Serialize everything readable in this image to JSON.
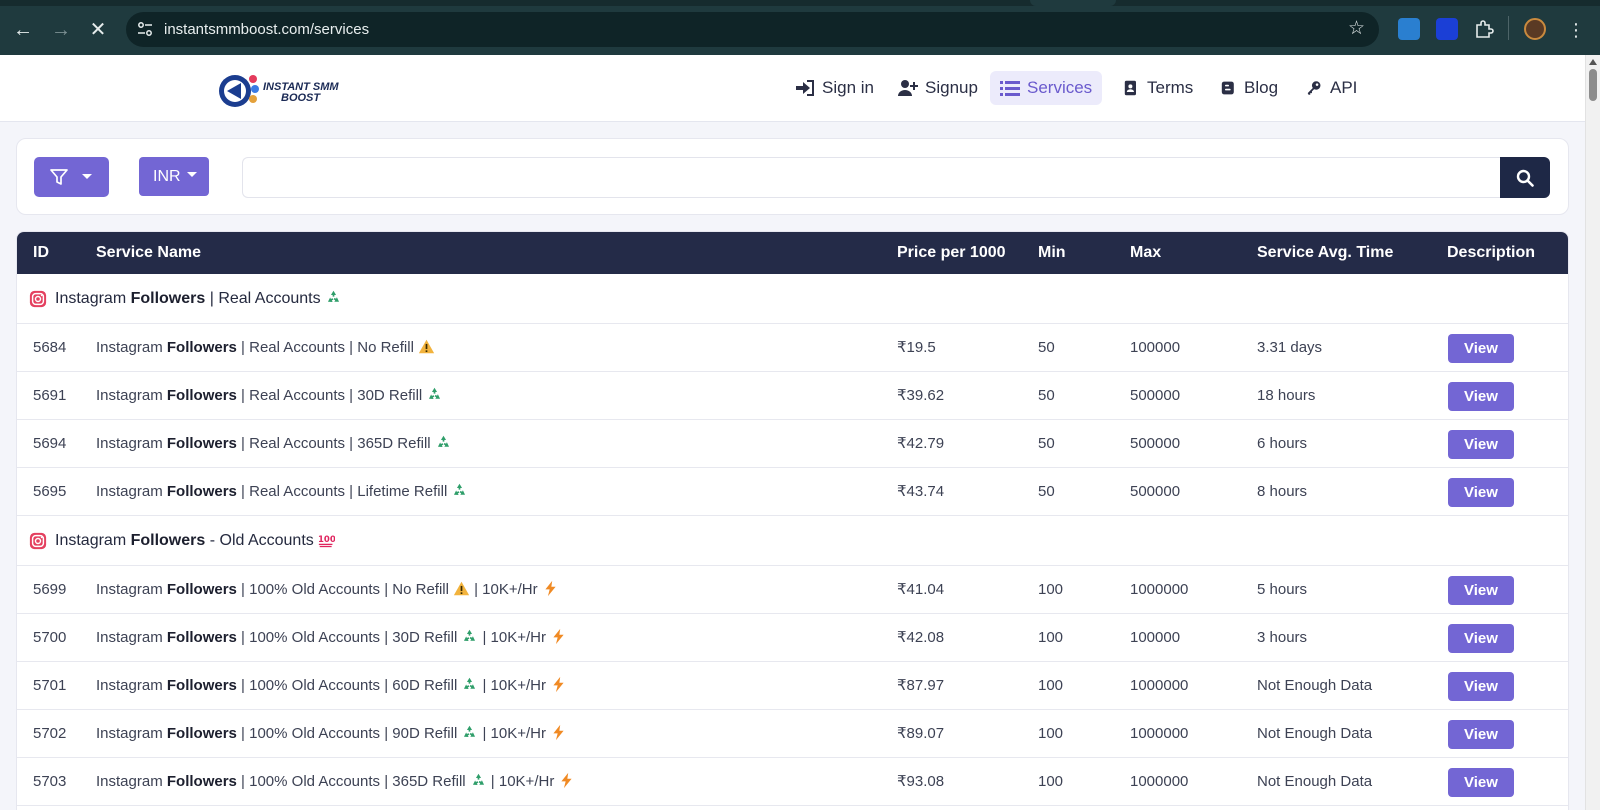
{
  "browser": {
    "url": "instantsmmboost.com/services"
  },
  "header": {
    "logo_text": "INSTANT SMM BOOST",
    "nav": [
      {
        "label": "Sign in",
        "icon": "sign-in-icon"
      },
      {
        "label": "Signup",
        "icon": "user-plus-icon"
      },
      {
        "label": "Services",
        "icon": "list-icon",
        "active": true
      },
      {
        "label": "Terms",
        "icon": "contact-card-icon"
      },
      {
        "label": "Blog",
        "icon": "blogger-icon"
      },
      {
        "label": "API",
        "icon": "key-icon"
      }
    ]
  },
  "filters": {
    "currency": "INR",
    "search_placeholder": ""
  },
  "table": {
    "headers": {
      "id": "ID",
      "name": "Service Name",
      "price": "Price per 1000",
      "min": "Min",
      "max": "Max",
      "avg": "Service Avg. Time",
      "desc": "Description"
    },
    "view_label": "View",
    "groups": [
      {
        "prefix": "Instagram ",
        "bold": "Followers",
        "suffix": " | Real Accounts",
        "emoji": "recycle-icon",
        "rows": [
          {
            "id": "5684",
            "prefix": "Instagram ",
            "bold": "Followers",
            "suffix": " | Real Accounts | No Refill",
            "tail": "",
            "emoji": "warning-icon",
            "price": "₹19.5",
            "min": "50",
            "max": "100000",
            "avg": "3.31 days"
          },
          {
            "id": "5691",
            "prefix": "Instagram ",
            "bold": "Followers",
            "suffix": " | Real Accounts | 30D Refill",
            "tail": "",
            "emoji": "recycle-icon",
            "price": "₹39.62",
            "min": "50",
            "max": "500000",
            "avg": "18 hours"
          },
          {
            "id": "5694",
            "prefix": "Instagram ",
            "bold": "Followers",
            "suffix": " | Real Accounts | 365D Refill",
            "tail": "",
            "emoji": "recycle-icon",
            "price": "₹42.79",
            "min": "50",
            "max": "500000",
            "avg": "6 hours"
          },
          {
            "id": "5695",
            "prefix": "Instagram ",
            "bold": "Followers",
            "suffix": " | Real Accounts | Lifetime Refill",
            "tail": "",
            "emoji": "recycle-icon",
            "price": "₹43.74",
            "min": "50",
            "max": "500000",
            "avg": "8 hours"
          }
        ]
      },
      {
        "prefix": "Instagram ",
        "bold": "Followers",
        "suffix": " - Old Accounts",
        "emoji": "hundred-icon",
        "rows": [
          {
            "id": "5699",
            "prefix": "Instagram ",
            "bold": "Followers",
            "suffix": " | 100% Old Accounts | No Refill",
            "tail": " | 10K+/Hr",
            "emoji": "warning-icon",
            "price": "₹41.04",
            "min": "100",
            "max": "1000000",
            "avg": "5 hours"
          },
          {
            "id": "5700",
            "prefix": "Instagram ",
            "bold": "Followers",
            "suffix": " | 100% Old Accounts | 30D Refill",
            "tail": " | 10K+/Hr",
            "emoji": "recycle-icon",
            "price": "₹42.08",
            "min": "100",
            "max": "100000",
            "avg": "3 hours"
          },
          {
            "id": "5701",
            "prefix": "Instagram ",
            "bold": "Followers",
            "suffix": " | 100% Old Accounts | 60D Refill",
            "tail": " | 10K+/Hr",
            "emoji": "recycle-icon",
            "price": "₹87.97",
            "min": "100",
            "max": "1000000",
            "avg": "Not Enough Data"
          },
          {
            "id": "5702",
            "prefix": "Instagram ",
            "bold": "Followers",
            "suffix": " | 100% Old Accounts | 90D Refill",
            "tail": " | 10K+/Hr",
            "emoji": "recycle-icon",
            "price": "₹89.07",
            "min": "100",
            "max": "1000000",
            "avg": "Not Enough Data"
          },
          {
            "id": "5703",
            "prefix": "Instagram ",
            "bold": "Followers",
            "suffix": " | 100% Old Accounts | 365D Refill",
            "tail": " | 10K+/Hr",
            "emoji": "recycle-icon",
            "price": "₹93.08",
            "min": "100",
            "max": "1000000",
            "avg": "Not Enough Data"
          }
        ]
      }
    ]
  },
  "colors": {
    "accent": "#7366d4",
    "table_header": "#242b48",
    "browser_frame": "#1f3a3e"
  }
}
